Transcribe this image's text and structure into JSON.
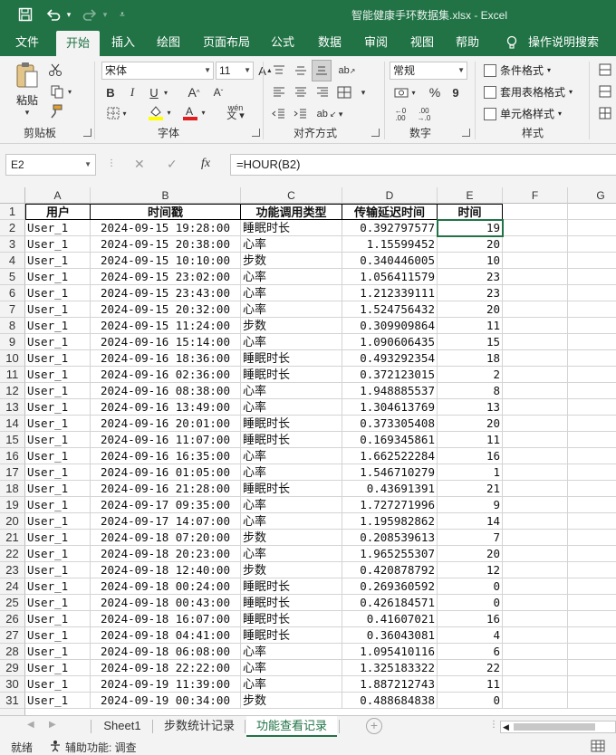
{
  "window": {
    "title": "智能健康手环数据集.xlsx  -  Excel"
  },
  "ribbon_tabs": [
    "文件",
    "开始",
    "插入",
    "绘图",
    "页面布局",
    "公式",
    "数据",
    "审阅",
    "视图",
    "帮助",
    "操作说明搜索"
  ],
  "ribbon": {
    "paste_label": "粘贴",
    "clipboard_group": "剪贴板",
    "font_name": "宋体",
    "font_size": "11",
    "font_group": "字体",
    "align_group": "对齐方式",
    "number_format": "常规",
    "number_group": "数字",
    "conditional_format": "条件格式",
    "table_format": "套用表格格式",
    "cell_styles": "单元格样式",
    "styles_group": "样式",
    "bold": "B",
    "italic": "I",
    "underline": "U",
    "percent": "%",
    "comma": "9",
    "wen": "wén"
  },
  "formula_bar": {
    "name_box": "E2",
    "fx": "fx",
    "formula": "=HOUR(B2)"
  },
  "columns": [
    "A",
    "B",
    "C",
    "D",
    "E",
    "F",
    "G"
  ],
  "header_row": [
    "用户",
    "时间戳",
    "功能调用类型",
    "传输延迟时间",
    "时间"
  ],
  "rows": [
    [
      "User_1",
      "2024-09-15 19:28:00",
      "睡眠时长",
      "0.392797577",
      "19"
    ],
    [
      "User_1",
      "2024-09-15 20:38:00",
      "心率",
      "1.15599452",
      "20"
    ],
    [
      "User_1",
      "2024-09-15 10:10:00",
      "步数",
      "0.340446005",
      "10"
    ],
    [
      "User_1",
      "2024-09-15 23:02:00",
      "心率",
      "1.056411579",
      "23"
    ],
    [
      "User_1",
      "2024-09-15 23:43:00",
      "心率",
      "1.212339111",
      "23"
    ],
    [
      "User_1",
      "2024-09-15 20:32:00",
      "心率",
      "1.524756432",
      "20"
    ],
    [
      "User_1",
      "2024-09-15 11:24:00",
      "步数",
      "0.309909864",
      "11"
    ],
    [
      "User_1",
      "2024-09-16 15:14:00",
      "心率",
      "1.090606435",
      "15"
    ],
    [
      "User_1",
      "2024-09-16 18:36:00",
      "睡眠时长",
      "0.493292354",
      "18"
    ],
    [
      "User_1",
      "2024-09-16 02:36:00",
      "睡眠时长",
      "0.372123015",
      "2"
    ],
    [
      "User_1",
      "2024-09-16 08:38:00",
      "心率",
      "1.948885537",
      "8"
    ],
    [
      "User_1",
      "2024-09-16 13:49:00",
      "心率",
      "1.304613769",
      "13"
    ],
    [
      "User_1",
      "2024-09-16 20:01:00",
      "睡眠时长",
      "0.373305408",
      "20"
    ],
    [
      "User_1",
      "2024-09-16 11:07:00",
      "睡眠时长",
      "0.169345861",
      "11"
    ],
    [
      "User_1",
      "2024-09-16 16:35:00",
      "心率",
      "1.662522284",
      "16"
    ],
    [
      "User_1",
      "2024-09-16 01:05:00",
      "心率",
      "1.546710279",
      "1"
    ],
    [
      "User_1",
      "2024-09-16 21:28:00",
      "睡眠时长",
      "0.43691391",
      "21"
    ],
    [
      "User_1",
      "2024-09-17 09:35:00",
      "心率",
      "1.727271996",
      "9"
    ],
    [
      "User_1",
      "2024-09-17 14:07:00",
      "心率",
      "1.195982862",
      "14"
    ],
    [
      "User_1",
      "2024-09-18 07:20:00",
      "步数",
      "0.208539613",
      "7"
    ],
    [
      "User_1",
      "2024-09-18 20:23:00",
      "心率",
      "1.965255307",
      "20"
    ],
    [
      "User_1",
      "2024-09-18 12:40:00",
      "步数",
      "0.420878792",
      "12"
    ],
    [
      "User_1",
      "2024-09-18 00:24:00",
      "睡眠时长",
      "0.269360592",
      "0"
    ],
    [
      "User_1",
      "2024-09-18 00:43:00",
      "睡眠时长",
      "0.426184571",
      "0"
    ],
    [
      "User_1",
      "2024-09-18 16:07:00",
      "睡眠时长",
      "0.41607021",
      "16"
    ],
    [
      "User_1",
      "2024-09-18 04:41:00",
      "睡眠时长",
      "0.36043081",
      "4"
    ],
    [
      "User_1",
      "2024-09-18 06:08:00",
      "心率",
      "1.095410116",
      "6"
    ],
    [
      "User_1",
      "2024-09-18 22:22:00",
      "心率",
      "1.325183322",
      "22"
    ],
    [
      "User_1",
      "2024-09-19 11:39:00",
      "心率",
      "1.887212743",
      "11"
    ],
    [
      "User_1",
      "2024-09-19 00:34:00",
      "步数",
      "0.488684838",
      "0"
    ]
  ],
  "sheet_tabs": [
    "Sheet1",
    "步数统计记录",
    "功能查看记录"
  ],
  "active_sheet_index": 2,
  "status": {
    "ready": "就绪",
    "accessibility": "辅助功能: 调查"
  },
  "colors": {
    "excel_green": "#217346",
    "ribbon_bg": "#f3f3f3"
  }
}
